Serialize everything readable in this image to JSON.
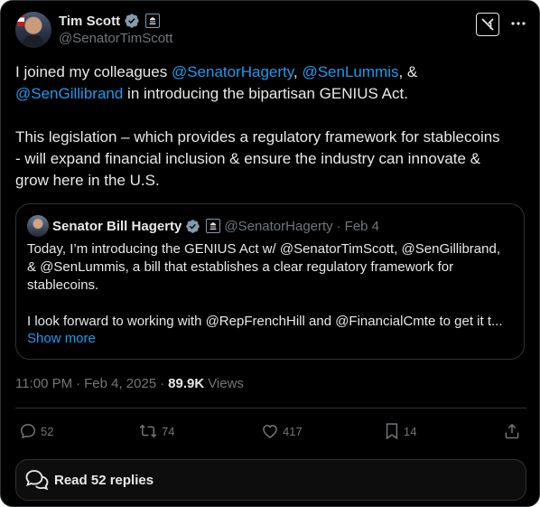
{
  "author": {
    "name": "Tim Scott",
    "handle": "@SenatorTimScott"
  },
  "tweet": {
    "line1_prefix": "I joined my colleagues ",
    "mention1": "@SenatorHagerty",
    "sep1": ", ",
    "mention2": "@SenLummis",
    "sep2": ", &",
    "mention3": "@SenGillibrand",
    "line2_suffix": " in introducing the bipartisan GENIUS Act.",
    "para2_line1": "This legislation – which provides a regulatory framework for stablecoins",
    "para2_line2": "- will expand financial inclusion & ensure the industry can innovate &",
    "para2_line3": "grow here in the U.S."
  },
  "quote": {
    "name": "Senator Bill Hagerty",
    "handle": "@SenatorHagerty",
    "dot": "·",
    "date": "Feb 4",
    "line1": "Today, I’m introducing the GENIUS Act w/ @SenatorTimScott, @SenGillibrand,",
    "line2": "& @SenLummis, a bill that establishes a clear regulatory framework for",
    "line3": "stablecoins.",
    "line4": "I look forward to working with @RepFrenchHill and @FinancialCmte to get it t...",
    "show_more": "Show more"
  },
  "meta": {
    "time": "11:00 PM",
    "dot1": "·",
    "date": "Feb 4, 2025",
    "dot2": "·",
    "views_count": "89.9K",
    "views_label": "Views"
  },
  "actions": {
    "replies": "52",
    "reposts": "74",
    "likes": "417",
    "bookmarks": "14"
  },
  "read_replies_label": "Read 52 replies",
  "colors": {
    "background": "#000000",
    "text": "#e7e9ea",
    "muted": "#71767b",
    "link": "#1d9bf0",
    "border": "#2f3336"
  },
  "icons": [
    "verified-badge-icon",
    "government-badge-icon",
    "grok-icon",
    "more-icon",
    "reply-icon",
    "repost-icon",
    "like-icon",
    "bookmark-icon",
    "share-icon",
    "chat-bubbles-icon"
  ]
}
